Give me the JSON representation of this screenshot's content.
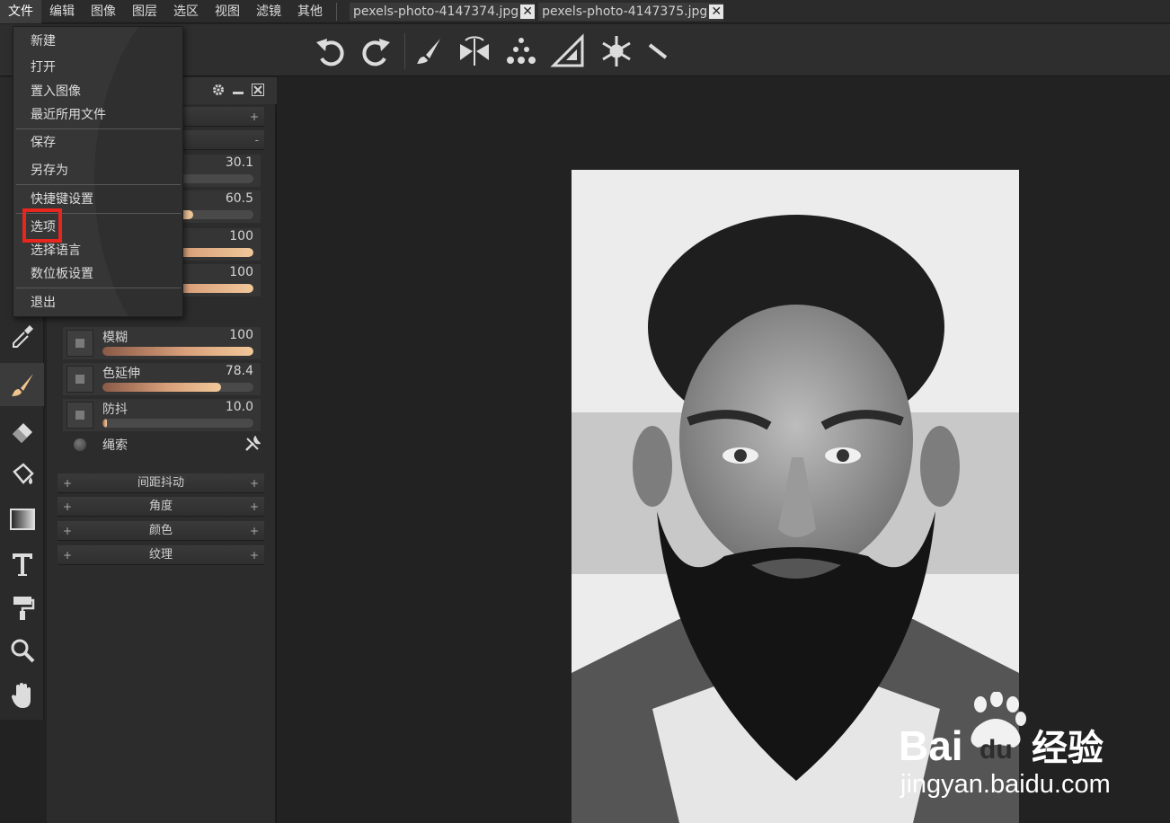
{
  "menubar": {
    "items": [
      "文件",
      "编辑",
      "图像",
      "图层",
      "选区",
      "视图",
      "滤镜",
      "其他"
    ],
    "tabs": [
      "pexels-photo-4147374.jpg",
      "pexels-photo-4147375.jpg"
    ]
  },
  "toolbar": {
    "buttons": [
      "undo-icon",
      "redo-icon",
      "brush-icon",
      "symmetry-icon",
      "scatter-icon",
      "ruler-triangle-icon",
      "snowflake-icon",
      "small-ruler-icon"
    ]
  },
  "tools": [
    "move-icon",
    "eyedropper-icon",
    "brush-icon",
    "eraser-icon",
    "paint-bucket-icon",
    "gradient-icon",
    "text-icon",
    "paint-roller-icon",
    "zoom-icon",
    "hand-icon"
  ],
  "file_menu": {
    "items": [
      "新建",
      "打开",
      "置入图像",
      "最近所用文件",
      "保存",
      "另存为",
      "快捷键设置",
      "选项",
      "选择语言",
      "数位板设置",
      "退出"
    ],
    "highlighted": "选项"
  },
  "brush_panel": {
    "params": [
      {
        "label": "",
        "value": "30.1",
        "fill": 0.0
      },
      {
        "label": "",
        "value": "60.5",
        "fill": 0.6
      },
      {
        "label": "",
        "value": "100",
        "fill": 1.0
      },
      {
        "label": "",
        "value": "100",
        "fill": 1.0
      },
      {
        "label": "模糊",
        "value": "100",
        "fill": 1.0
      },
      {
        "label": "色延伸",
        "value": "78.4",
        "fill": 0.784
      },
      {
        "label": "防抖",
        "value": "10.0",
        "fill": 0.03
      }
    ],
    "lasso_label": "绳索",
    "sections": [
      "间距抖动",
      "角度",
      "颜色",
      "纹理"
    ]
  },
  "watermark": {
    "brand": "Bai",
    "brand2": "du",
    "suffix": "经验",
    "url": "jingyan.baidu.com"
  },
  "colors": {
    "accent": "#e8261d",
    "slider": "#f1c89a"
  }
}
